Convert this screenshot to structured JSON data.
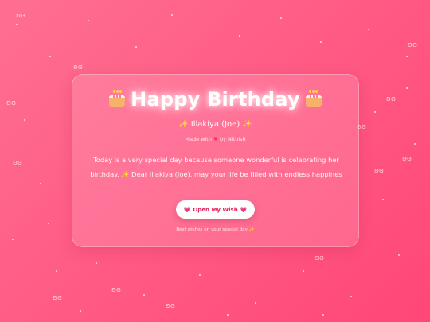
{
  "card": {
    "title": "Happy Birthday",
    "title_icon": "cake-icon",
    "recipient": "Illakiya (Joe)",
    "recipient_icon": "sparkles-icon",
    "made_with_prefix": "Made with",
    "made_with_suffix": "by Nithish",
    "made_with_icon": "heart-icon",
    "message": "Today is a very special day because someone wonderful is celebrating her birthday. ✨ Dear Illakiya (Joe), may your life be filled with endless happines",
    "button_label": "Open My Wish",
    "button_icon": "heart-icon",
    "footer": "Best wishes on your special day ✨"
  },
  "colors": {
    "background_start": "#ff6f91",
    "background_end": "#ff4777",
    "button_text": "#e0245e",
    "heart": "#ff2d55"
  }
}
